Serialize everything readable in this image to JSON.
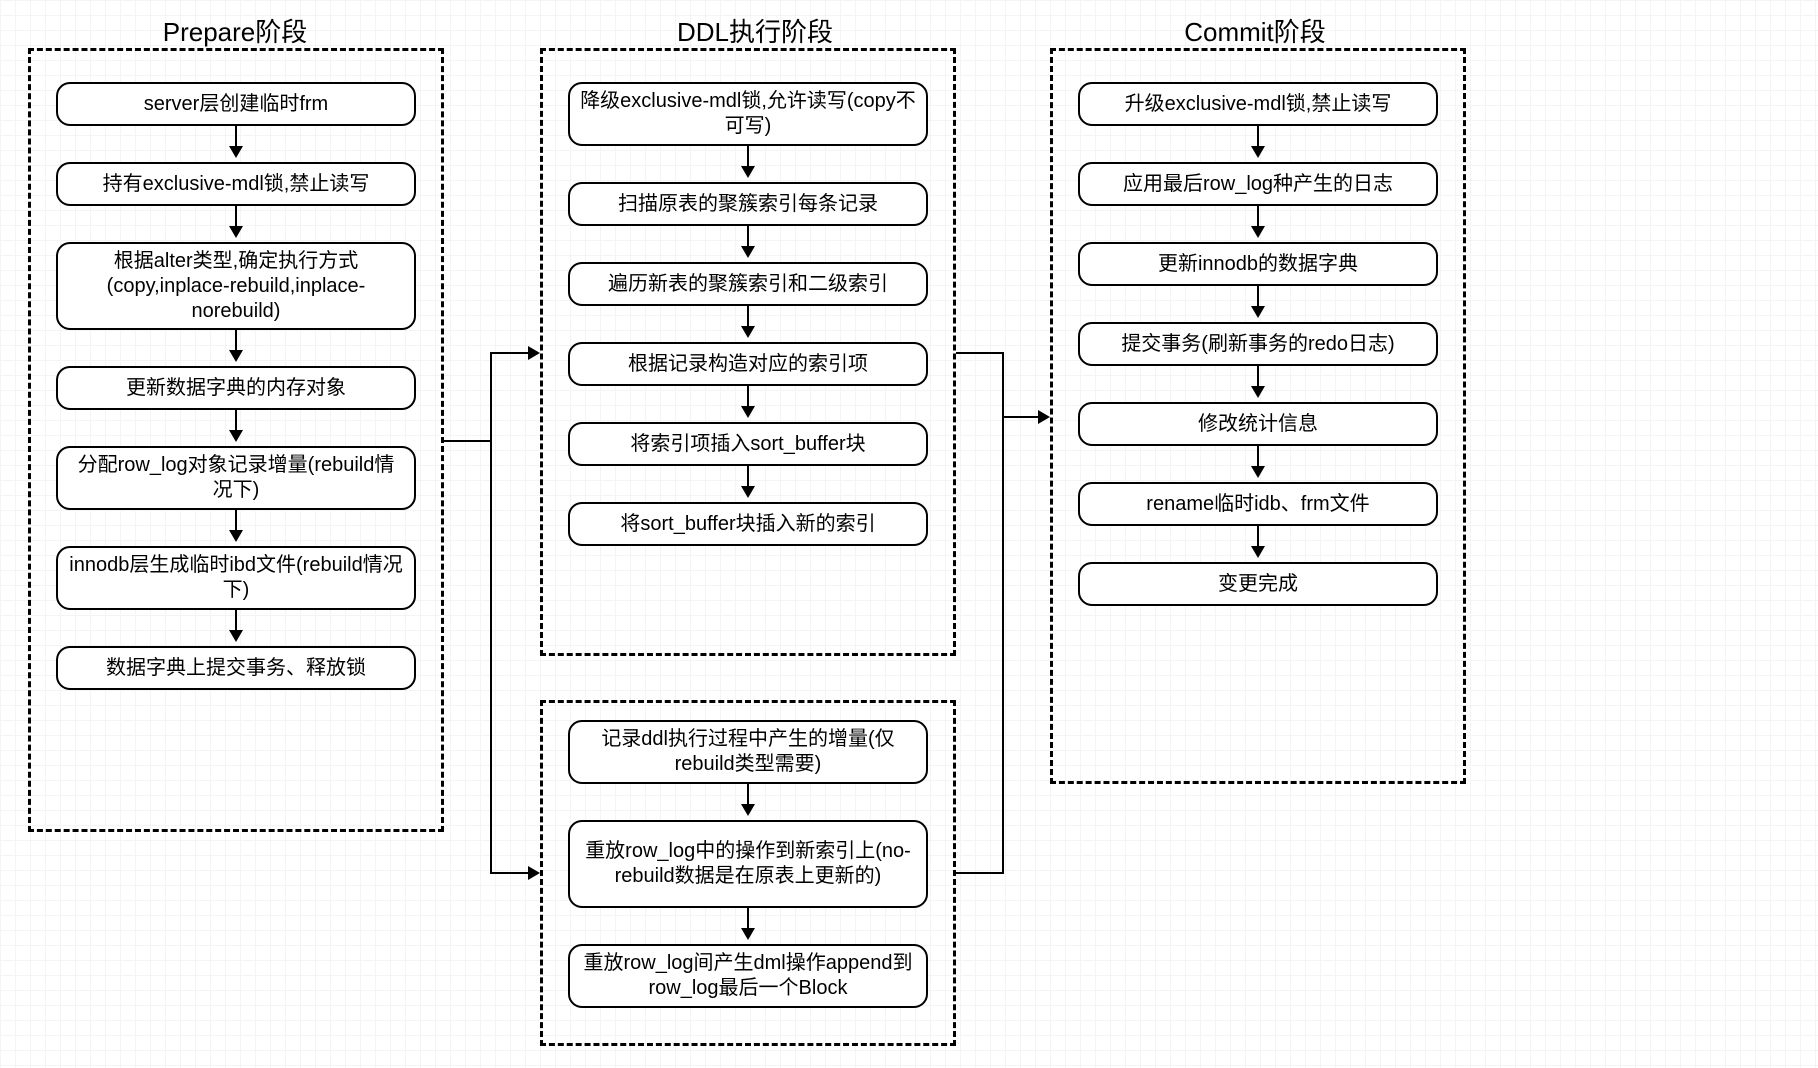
{
  "stages": {
    "prepare": {
      "title": "Prepare阶段",
      "nodes": [
        "server层创建临时frm",
        "持有exclusive-mdl锁,禁止读写",
        "根据alter类型,确定执行方式(copy,inplace-rebuild,inplace-norebuild)",
        "更新数据字典的内存对象",
        "分配row_log对象记录增量(rebuild情况下)",
        "innodb层生成临时ibd文件(rebuild情况下)",
        "数据字典上提交事务、释放锁"
      ]
    },
    "ddl": {
      "title": "DDL执行阶段",
      "box1_nodes": [
        "降级exclusive-mdl锁,允许读写(copy不可写)",
        "扫描原表的聚簇索引每条记录",
        "遍历新表的聚簇索引和二级索引",
        "根据记录构造对应的索引项",
        "将索引项插入sort_buffer块",
        "将sort_buffer块插入新的索引"
      ],
      "box2_nodes": [
        "记录ddl执行过程中产生的增量(仅rebuild类型需要)",
        "重放row_log中的操作到新索引上(no-rebuild数据是在原表上更新的)",
        "重放row_log间产生dml操作append到row_log最后一个Block"
      ]
    },
    "commit": {
      "title": "Commit阶段",
      "nodes": [
        "升级exclusive-mdl锁,禁止读写",
        "应用最后row_log种产生的日志",
        "更新innodb的数据字典",
        "提交事务(刷新事务的redo日志)",
        "修改统计信息",
        "rename临时idb、frm文件",
        "变更完成"
      ]
    }
  }
}
